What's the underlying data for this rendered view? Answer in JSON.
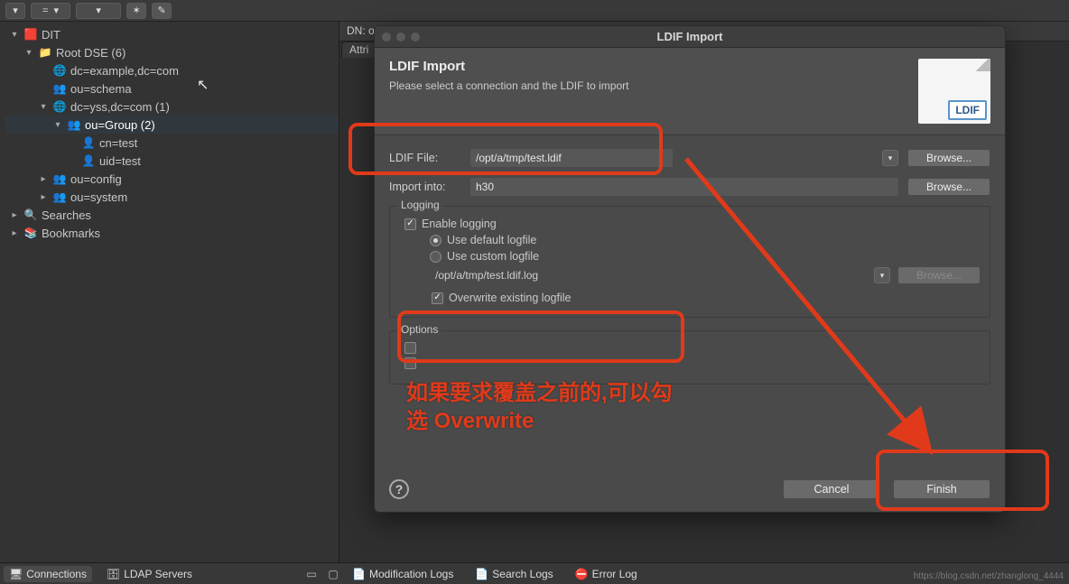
{
  "toolbar": {
    "eq": "="
  },
  "tree": {
    "dit": "DIT",
    "root": "Root DSE (6)",
    "dc_example": "dc=example,dc=com",
    "ou_schema": "ou=schema",
    "dc_yss": "dc=yss,dc=com (1)",
    "ou_group": "ou=Group (2)",
    "cn_test": "cn=test",
    "uid_test": "uid=test",
    "ou_config": "ou=config",
    "ou_system": "ou=system",
    "searches": "Searches",
    "bookmarks": "Bookmarks"
  },
  "dn_bar": "DN: ou=Group,dc=yss,dc=com",
  "attr_tab": "Attri",
  "dialog": {
    "title": "LDIF Import",
    "header_title": "LDIF Import",
    "header_sub": "Please select a connection and the LDIF to import",
    "badge": "LDIF",
    "ldif_file_label": "LDIF File:",
    "ldif_file_value": "/opt/a/tmp/test.ldif",
    "import_into_label": "Import into:",
    "import_into_value": "h30",
    "browse": "Browse...",
    "logging_legend": "Logging",
    "enable_logging": "Enable logging",
    "use_default_log": "Use default logfile",
    "use_custom_log": "Use custom logfile",
    "log_path": "/opt/a/tmp/test.ldif.log",
    "overwrite_log": "Overwrite existing logfile",
    "options_legend": "Options",
    "cancel": "Cancel",
    "finish": "Finish"
  },
  "annotation": {
    "line1": "如果要求覆盖之前的,可以勾",
    "line2": "选 Overwrite"
  },
  "bottom": {
    "connections": "Connections",
    "ldap_servers": "LDAP Servers",
    "mod_logs": "Modification Logs",
    "search_logs": "Search Logs",
    "error_log": "Error Log"
  },
  "watermark": "https://blog.csdn.net/zhanglong_4444"
}
